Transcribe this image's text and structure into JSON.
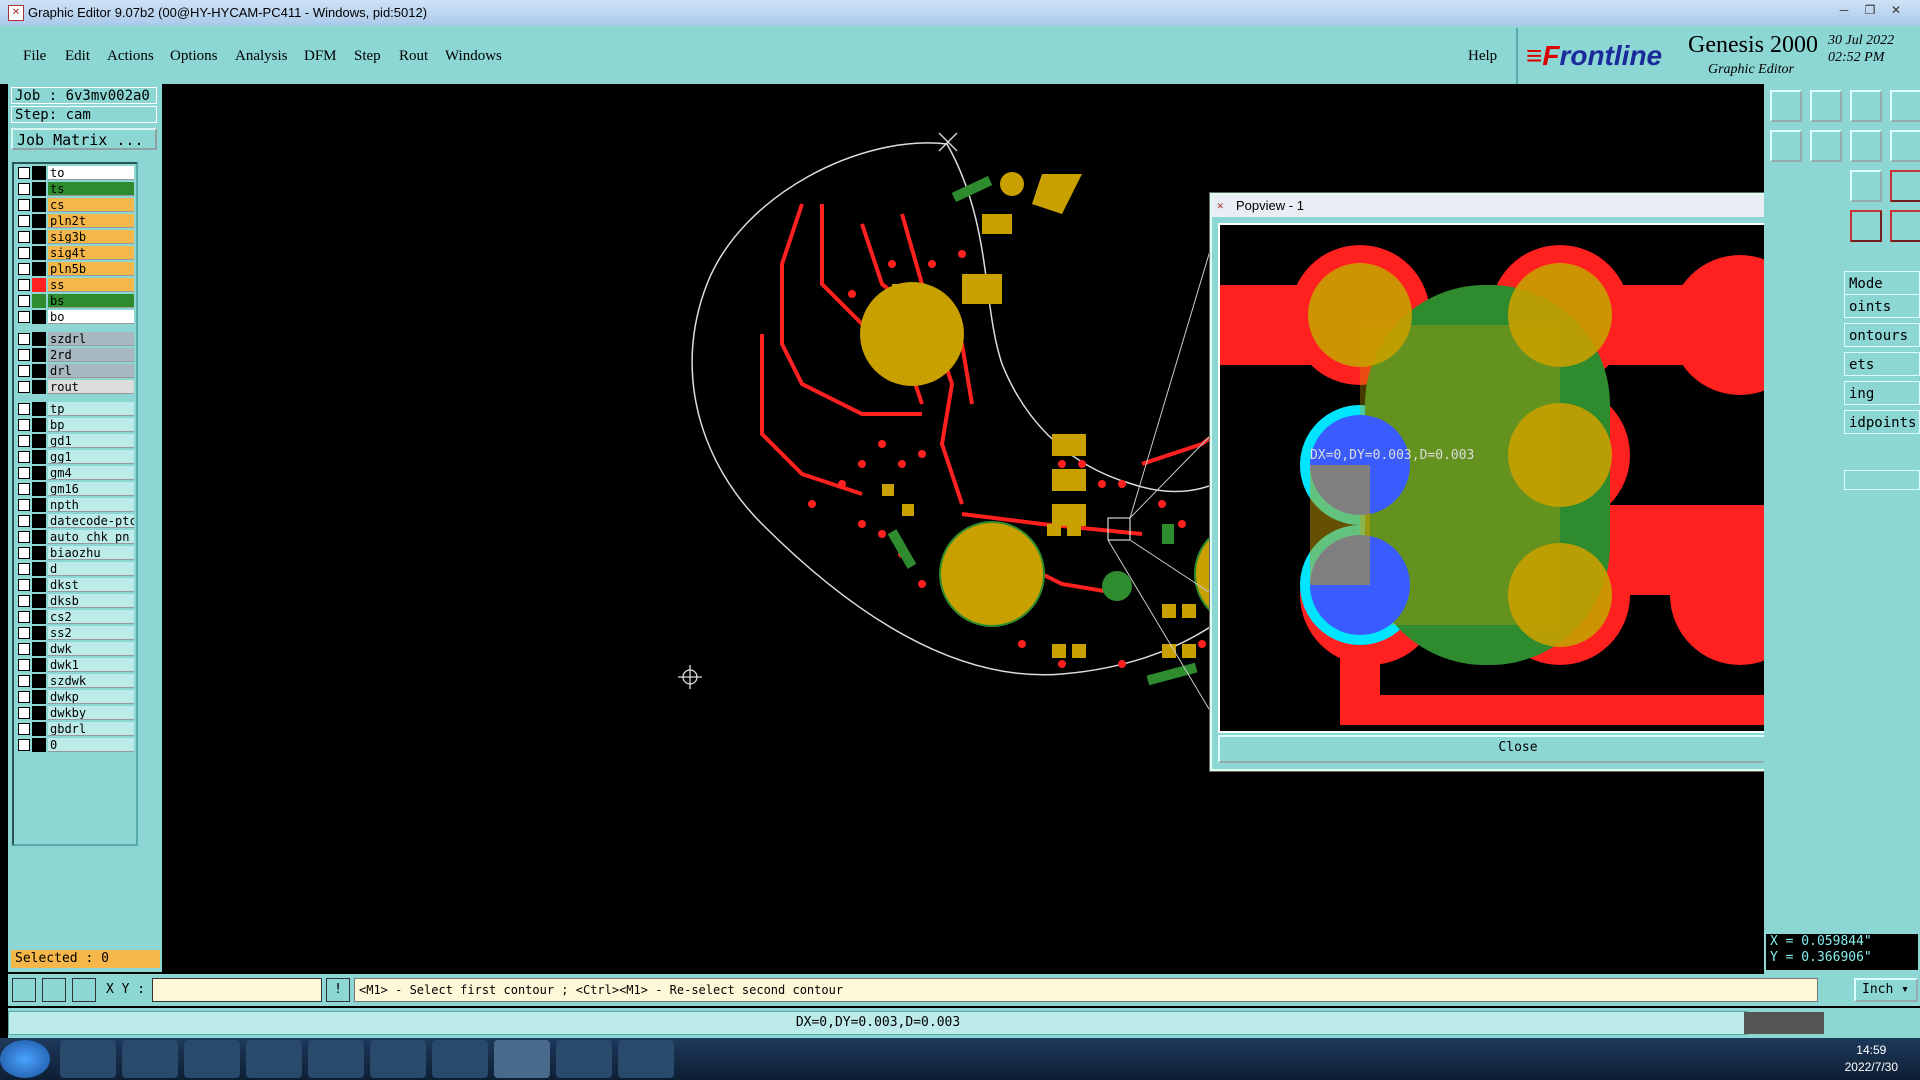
{
  "window": {
    "title": "Graphic Editor 9.07b2 (00@HY-HYCAM-PC411 - Windows, pid:5012)"
  },
  "menu": {
    "items": [
      "File",
      "Edit",
      "Actions",
      "Options",
      "Analysis",
      "DFM",
      "Step",
      "Rout",
      "Windows"
    ],
    "help": "Help"
  },
  "brand": {
    "logo_prefix": "F",
    "logo_rest": "rontline",
    "product": "Genesis 2000",
    "sub": "Graphic Editor",
    "date": "30 Jul 2022",
    "time": "02:52 PM"
  },
  "job": {
    "job_label": "Job : 6v3mv002a0",
    "step_label": "Step: cam",
    "matrix_button": "Job Matrix ..."
  },
  "layers": [
    {
      "name": "to",
      "color": "#ffffff",
      "swatch": "#000000"
    },
    {
      "name": "ts",
      "color": "#2e8b2e",
      "swatch": "#000000"
    },
    {
      "name": "cs",
      "color": "#f5b74a",
      "swatch": "#000000"
    },
    {
      "name": "pln2t",
      "color": "#f5b74a",
      "swatch": "#000000"
    },
    {
      "name": "sig3b",
      "color": "#f5b74a",
      "swatch": "#000000"
    },
    {
      "name": "sig4t",
      "color": "#f5b74a",
      "swatch": "#000000"
    },
    {
      "name": "pln5b",
      "color": "#f5b74a",
      "swatch": "#000000"
    },
    {
      "name": "ss",
      "color": "#f5b74a",
      "swatch": "#ff2020"
    },
    {
      "name": "bs",
      "color": "#2e8b2e",
      "swatch": "#2e8b2e"
    },
    {
      "name": "bo",
      "color": "#ffffff",
      "swatch": "#000000"
    },
    {
      "name": "szdrl",
      "color": "#a8b8c0",
      "swatch": "#000000"
    },
    {
      "name": "2rd",
      "color": "#a8b8c0",
      "swatch": "#000000"
    },
    {
      "name": "drl",
      "color": "#a8b8c0",
      "swatch": "#000000"
    },
    {
      "name": "rout",
      "color": "#dcdcdc",
      "swatch": "#000000"
    },
    {
      "name": "tp",
      "color": "#bdebea",
      "swatch": "#000000"
    },
    {
      "name": "bp",
      "color": "#bdebea",
      "swatch": "#000000"
    },
    {
      "name": "gd1",
      "color": "#bdebea",
      "swatch": "#000000"
    },
    {
      "name": "gg1",
      "color": "#bdebea",
      "swatch": "#000000"
    },
    {
      "name": "gm4",
      "color": "#bdebea",
      "swatch": "#000000"
    },
    {
      "name": "gm16",
      "color": "#bdebea",
      "swatch": "#000000"
    },
    {
      "name": "npth",
      "color": "#bdebea",
      "swatch": "#000000"
    },
    {
      "name": "datecode-ptc",
      "color": "#bdebea",
      "swatch": "#000000"
    },
    {
      "name": "auto_chk_pn",
      "color": "#bdebea",
      "swatch": "#000000"
    },
    {
      "name": "biaozhu",
      "color": "#bdebea",
      "swatch": "#000000"
    },
    {
      "name": "d",
      "color": "#bdebea",
      "swatch": "#000000"
    },
    {
      "name": "dkst",
      "color": "#bdebea",
      "swatch": "#000000"
    },
    {
      "name": "dksb",
      "color": "#bdebea",
      "swatch": "#000000"
    },
    {
      "name": "cs2",
      "color": "#bdebea",
      "swatch": "#000000"
    },
    {
      "name": "ss2",
      "color": "#bdebea",
      "swatch": "#000000"
    },
    {
      "name": "dwk",
      "color": "#bdebea",
      "swatch": "#000000"
    },
    {
      "name": "dwk1",
      "color": "#bdebea",
      "swatch": "#000000"
    },
    {
      "name": "szdwk",
      "color": "#bdebea",
      "swatch": "#000000"
    },
    {
      "name": "dwkp",
      "color": "#bdebea",
      "swatch": "#000000"
    },
    {
      "name": "dwkby",
      "color": "#bdebea",
      "swatch": "#000000"
    },
    {
      "name": "gbdrl",
      "color": "#bdebea",
      "swatch": "#000000"
    },
    {
      "name": "0",
      "color": "#bdebea",
      "swatch": "#000000"
    }
  ],
  "selected": "Selected : 0",
  "popview": {
    "title": "Popview - 1",
    "close_label": "Close",
    "measure": "DX=0,DY=0.003,D=0.003"
  },
  "right_panel": {
    "modes": [
      "Mode",
      "oints",
      "ontours",
      "ets",
      "ing",
      "idpoints"
    ],
    "x": "X = 0.059844\"",
    "y": "Y = 0.366906\""
  },
  "command": {
    "xy_label": "X Y :",
    "prompt": "<M1> - Select first contour ; <Ctrl><M1> - Re-select second contour",
    "units": "Inch"
  },
  "status": "DX=0,DY=0.003,D=0.003",
  "taskbar": {
    "time": "14:59",
    "date": "2022/7/30"
  },
  "colors": {
    "panel": "#8cd6d4",
    "copper": "#c8a000",
    "trace": "#ff2020",
    "mask": "#2e8b2e",
    "drill": "#3a5cff",
    "highlight": "#00e5ff"
  }
}
